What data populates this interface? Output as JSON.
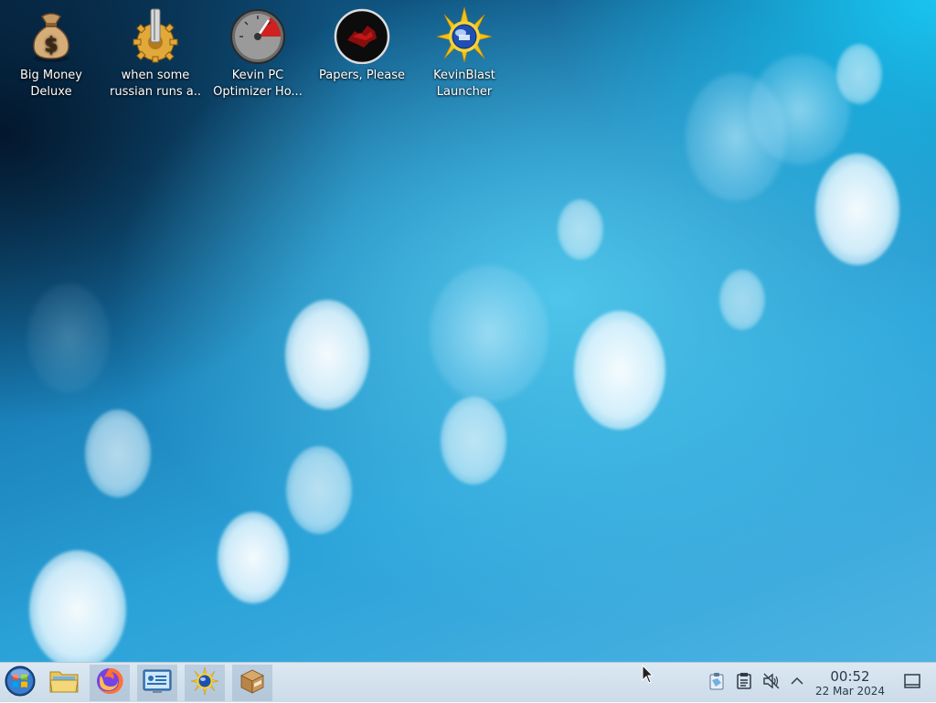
{
  "desktop": {
    "icons": [
      {
        "line1": "Big Money",
        "line2": "Deluxe",
        "icon": "money-bag-icon"
      },
      {
        "line1": "when some",
        "line2": "russian runs a...",
        "icon": "gear-icon"
      },
      {
        "line1": "Kevin PC",
        "line2": "Optimizer Ho...",
        "icon": "speedometer-icon"
      },
      {
        "line1": "Papers, Please",
        "line2": "",
        "icon": "papers-please-icon"
      },
      {
        "line1": "KevinBlast",
        "line2": "Launcher",
        "icon": "sun-globe-icon"
      }
    ]
  },
  "taskbar": {
    "items": [
      {
        "icon": "start-menu-orb-icon"
      },
      {
        "icon": "file-manager-folder-icon"
      },
      {
        "icon": "firefox-icon"
      },
      {
        "icon": "system-settings-icon"
      },
      {
        "icon": "kevinblast-sun-globe-icon"
      },
      {
        "icon": "package-box-icon"
      }
    ],
    "tray": {
      "icons": [
        "clipboard-icon",
        "notes-icon",
        "volume-muted-icon",
        "chevron-up-icon"
      ],
      "clock": {
        "time": "00:52",
        "date": "22 Mar 2024"
      },
      "show_desktop_icon": "show-desktop-icon"
    }
  },
  "colors": {
    "taskbar_bg": "#d6e3ee",
    "wallpaper_accent": "#1aa6dc"
  }
}
